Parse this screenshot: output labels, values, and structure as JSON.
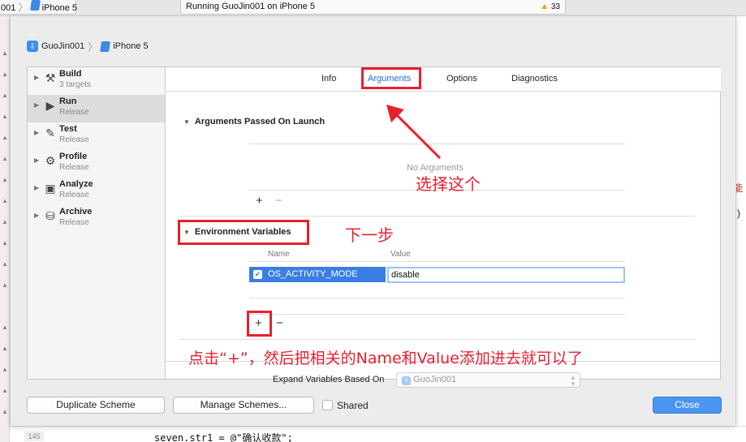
{
  "topbar": {
    "scheme_suffix": "001",
    "device": "iPhone 5",
    "status": "Running GuoJin001 on iPhone 5",
    "warnings": "33"
  },
  "breadcrumb": {
    "project": "GuoJin001",
    "device": "iPhone 5"
  },
  "sidebar": {
    "items": [
      {
        "name": "Build",
        "sub": "3 targets",
        "icon": "hammer-icon"
      },
      {
        "name": "Run",
        "sub": "Release",
        "icon": "play-icon"
      },
      {
        "name": "Test",
        "sub": "Release",
        "icon": "wrench-icon"
      },
      {
        "name": "Profile",
        "sub": "Release",
        "icon": "gauge-icon"
      },
      {
        "name": "Analyze",
        "sub": "Release",
        "icon": "analyze-icon"
      },
      {
        "name": "Archive",
        "sub": "Release",
        "icon": "archive-icon"
      }
    ]
  },
  "tabs": {
    "info": "Info",
    "arguments": "Arguments",
    "options": "Options",
    "diagnostics": "Diagnostics"
  },
  "arguments_section": {
    "title": "Arguments Passed On Launch",
    "placeholder": "No Arguments"
  },
  "env_section": {
    "title": "Environment Variables",
    "col_name": "Name",
    "col_value": "Value",
    "rows": [
      {
        "enabled": true,
        "name": "OS_ACTIVITY_MODE",
        "value": "disable"
      }
    ]
  },
  "expand": {
    "label": "Expand Variables Based On",
    "value": "GuoJin001"
  },
  "annotations": {
    "select_this": "选择这个",
    "next_step": "下一步",
    "instruction": "点击“+”，然后把相关的Name和Value添加进去就可以了"
  },
  "buttons": {
    "duplicate": "Duplicate Scheme",
    "manage": "Manage Schemes...",
    "shared": "Shared",
    "close": "Close"
  },
  "code": {
    "line_number": "145",
    "line": "seven.str1 = @\"确认收款\";",
    "right_text_1": "能",
    "right_text_2": ")"
  },
  "colors": {
    "accent": "#1e6fe0",
    "annotation_red": "#e8202e",
    "selection": "#3b7ee3"
  }
}
